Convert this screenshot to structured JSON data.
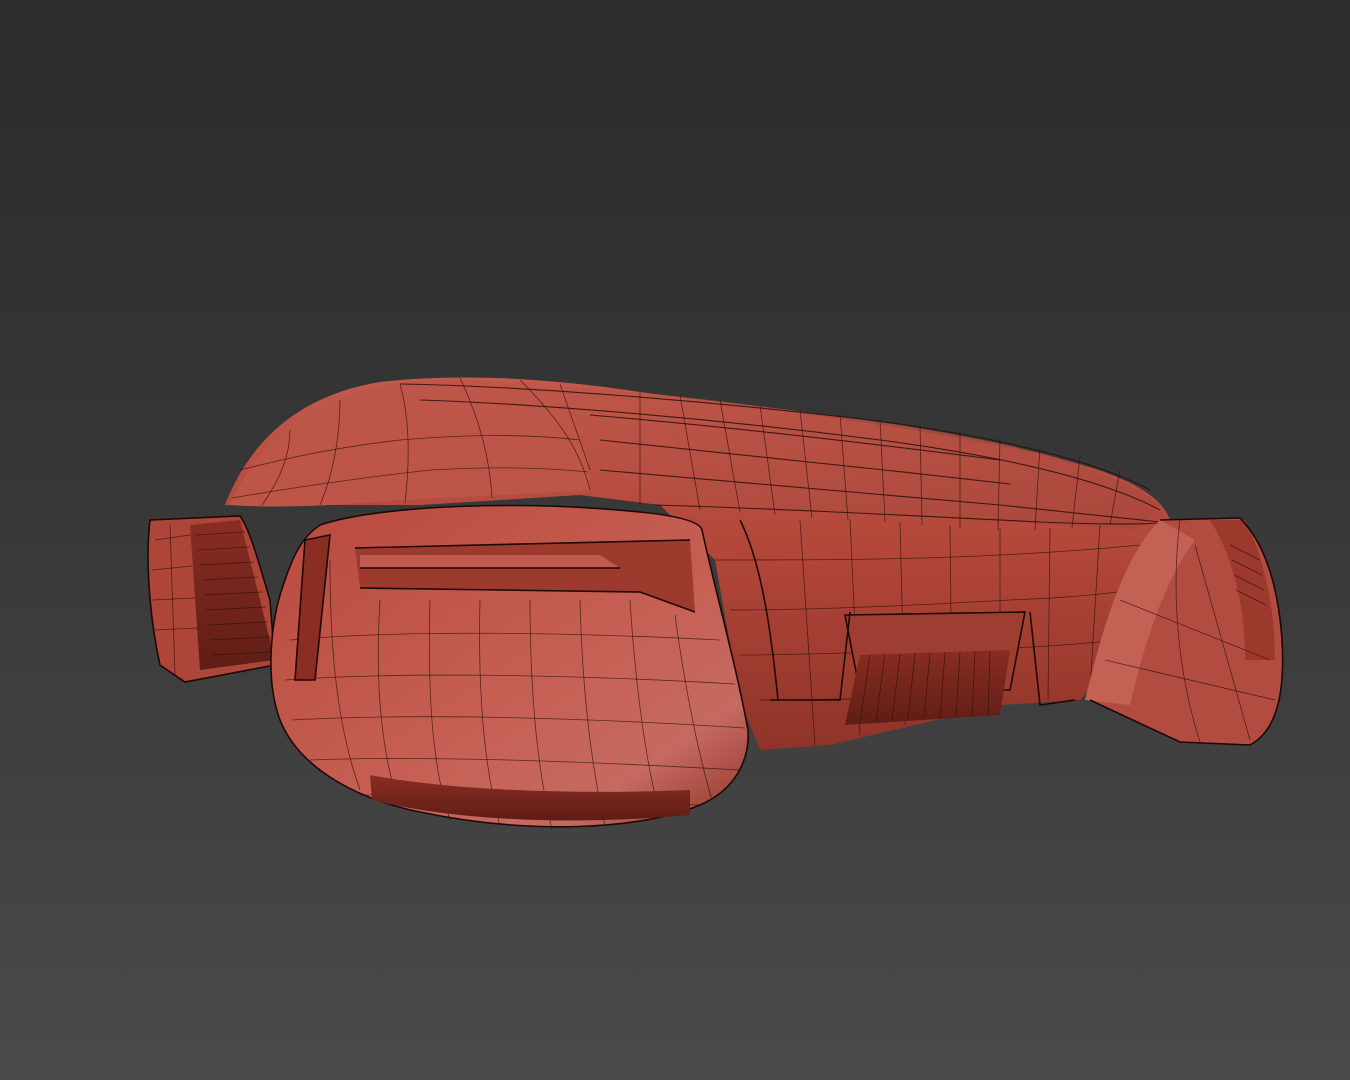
{
  "viewport": {
    "background_top": "#2c2c2c",
    "background_bottom": "#4a4a4a"
  },
  "model": {
    "shading": "wireframe-on-shaded",
    "surface_color": "#b24a3e",
    "highlight_color": "#c9655a",
    "shadow_color": "#6e2219",
    "wire_color": "#2a0e0a"
  }
}
